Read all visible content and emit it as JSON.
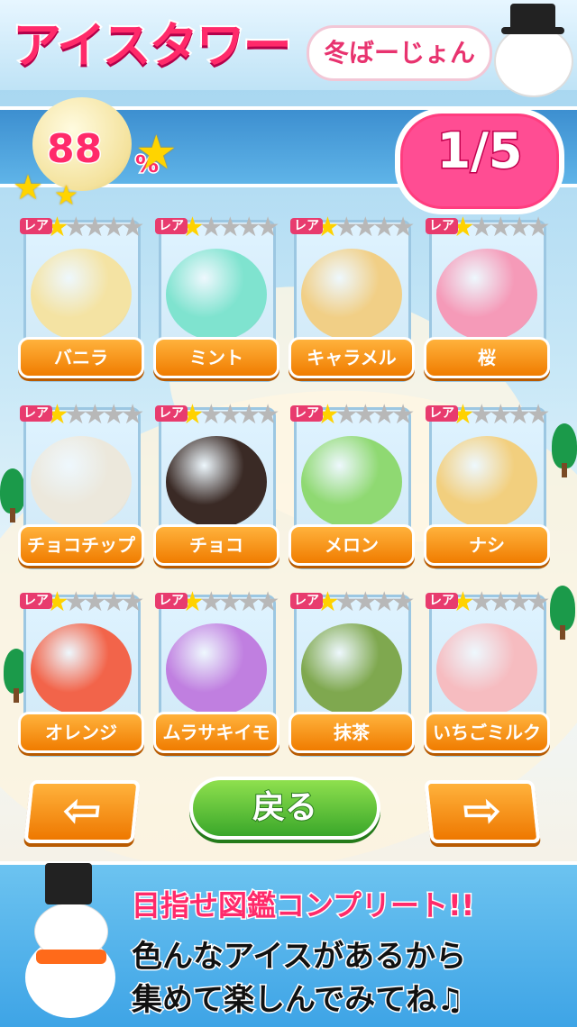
{
  "header": {
    "title": "アイスタワー",
    "subtitle": "冬ばーじょん"
  },
  "status": {
    "percent_value": "88",
    "percent_sign": "%",
    "page": "1/5"
  },
  "rarity_label": "レア",
  "flavors": [
    {
      "name": "バニラ",
      "rarity": 1,
      "color": "#f4e3a3"
    },
    {
      "name": "ミント",
      "rarity": 1,
      "color": "#7fe3cf"
    },
    {
      "name": "キャラメル",
      "rarity": 1,
      "color": "#f1cf86"
    },
    {
      "name": "桜",
      "rarity": 1,
      "color": "#f59ab8"
    },
    {
      "name": "チョコチップ",
      "rarity": 1,
      "color": "#ece8dc"
    },
    {
      "name": "チョコ",
      "rarity": 1,
      "color": "#3a2a25"
    },
    {
      "name": "メロン",
      "rarity": 1,
      "color": "#8fd972"
    },
    {
      "name": "ナシ",
      "rarity": 1,
      "color": "#f2cf7e"
    },
    {
      "name": "オレンジ",
      "rarity": 1,
      "color": "#f2644a"
    },
    {
      "name": "ムラサキイモ",
      "rarity": 1,
      "color": "#c07fe0"
    },
    {
      "name": "抹茶",
      "rarity": 1,
      "color": "#7fa84f"
    },
    {
      "name": "いちごミルク",
      "rarity": 1,
      "color": "#f6bcc0"
    }
  ],
  "nav": {
    "prev_icon": "left-arrow-icon",
    "next_icon": "right-arrow-icon",
    "back_label": "戻る"
  },
  "footer": {
    "line1": "目指せ図鑑コンプリート!!",
    "line2": "色んなアイスがあるから",
    "line3": "集めて楽しんでみてね♫"
  }
}
